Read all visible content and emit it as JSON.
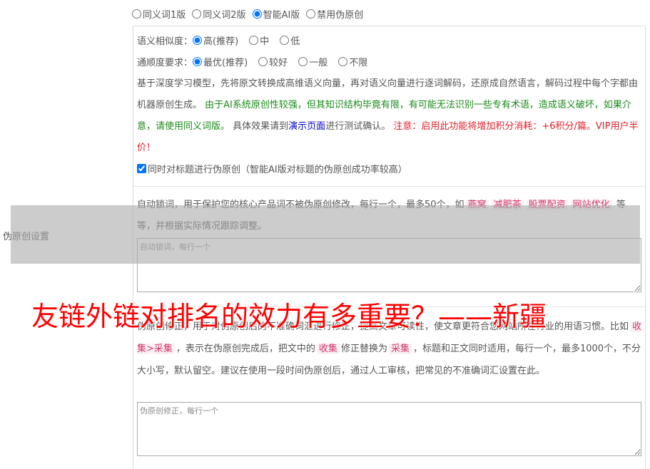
{
  "left_label": "伪原创设置",
  "mode_options": [
    {
      "label": "同义词1版",
      "checked": false
    },
    {
      "label": "同义词2版",
      "checked": false
    },
    {
      "label": "智能AI版",
      "checked": true
    },
    {
      "label": "禁用伪原创",
      "checked": false
    }
  ],
  "similarity": {
    "label": "语义相似度：",
    "options": [
      {
        "label": "高(推荐)",
        "checked": true
      },
      {
        "label": "中",
        "checked": false
      },
      {
        "label": "低",
        "checked": false
      }
    ]
  },
  "fluency": {
    "label": "通顺度要求：",
    "options": [
      {
        "label": "最优(推荐)",
        "checked": true
      },
      {
        "label": "较好",
        "checked": false
      },
      {
        "label": "一般",
        "checked": false
      },
      {
        "label": "不限",
        "checked": false
      }
    ]
  },
  "ai_desc": {
    "intro": "基于深度学习模型，先将原文转换成高维语义向量，再对语义向量进行逐词解码，还原成自然语言，解码过程中每个字都由机器原创生成。",
    "warning_green": "由于AI系统原创性较强，但其知识结构毕竟有限，有可能无法识别一些专有术语，造成语义破坏，如果介意，请使用同义词版。",
    "effect_prefix": "具体效果请到",
    "effect_link": "演示页面",
    "effect_suffix": "进行测试确认。",
    "note_red": "注意：启用此功能将增加积分消耗：+6积分/篇。VIP用户半价！"
  },
  "title_checkbox": {
    "label": "同时对标题进行伪原创（智能AI版对标题的伪原创成功率较高）",
    "checked": true
  },
  "lock_words": {
    "desc_before": "自动锁词，用于保护您的核心产品词不被伪原创修改，每行一个，最多50个，如",
    "examples": [
      "燕窝",
      "减肥茶",
      "股票配资",
      "网站优化"
    ],
    "desc_after": "等等，并根据实际情况跟踪调整。",
    "placeholder": "自动锁词，每行一个"
  },
  "correction": {
    "desc_start": "伪原创修正，用于对伪原创后的不准确词汇进行修正，提高文章可读性，使文章更符合您网站所在行业的用语习惯。比如",
    "example_rule": "收集>采集",
    "desc_mid1": "，表示在伪原创完成后，把文中的",
    "example_from": "收集",
    "desc_mid2": "修正替换为",
    "example_to": "采集",
    "desc_end": "，标题和正文同时适用，每行一个，最多1000个，不分大小写，默认留空。建议在使用一段时间伪原创后，通过人工审核，把常见的不准确词汇设置在此。",
    "placeholder": "伪原创修正，每行一个"
  },
  "watermark": "友链外链对排名的效力有多重要？——新疆",
  "colors": {
    "green": "#1a8a1a",
    "red": "#e0202a",
    "link": "#0000cc",
    "keyword": "#d6336c"
  }
}
